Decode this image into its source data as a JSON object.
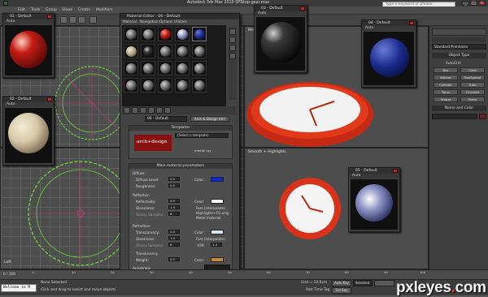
{
  "app": {
    "title": "Autodesk 3ds Max 2010 SP1",
    "file": "Stop-gear.max"
  },
  "menu": [
    "Edit",
    "Tools",
    "Group",
    "Views",
    "Create",
    "Modifiers",
    "Animation",
    "Graph Editors",
    "Rendering",
    "Customize",
    "MAXScript",
    "Help"
  ],
  "search": {
    "placeholder": "Type a keyword or phrase"
  },
  "viewports": {
    "top_left": "Top",
    "top_right": "Perspective",
    "bottom_left": "Left",
    "bottom_right": "Smooth + Highlights"
  },
  "mini_windows": [
    {
      "title": "01 - Default",
      "auto": "Auto",
      "sphere_color": "#c41c14"
    },
    {
      "title": "02 - Default",
      "auto": "Auto",
      "sphere_color": "#d8c9a8"
    },
    {
      "title": "03 - Default",
      "auto": "Auto",
      "sphere_color": "#111111"
    },
    {
      "title": "04 - Default",
      "auto": "Auto",
      "sphere_color": "#1a2c8c"
    },
    {
      "title": "05 - Default",
      "auto": "Auto",
      "sphere_color": "#8e94c4"
    }
  ],
  "material_editor": {
    "title": "Material Editor - 06 - Default",
    "menu": [
      "Material",
      "Navigation",
      "Options",
      "Utilities"
    ],
    "name_field": "06 - Default",
    "type_button": "Arch & Design (mi)",
    "templates_head": "Templates",
    "templates_select": "(Select a template)",
    "logo_text": "arch+design",
    "logo_sub": "mental ray",
    "main_head": "Main material parameters",
    "diffuse": {
      "label": "Diffuse",
      "level_label": "Diffuse Level:",
      "level": "0.0",
      "rough_label": "Roughness:",
      "rough": "0.0",
      "color_label": "Color:",
      "color": "#0a28d8"
    },
    "reflection": {
      "label": "Reflection",
      "refl_label": "Reflectivity:",
      "refl": "0.0",
      "gloss_label": "Glossiness:",
      "gloss": "1.0",
      "samples_label": "Glossy Samples:",
      "samples": "8",
      "color_label": "Color:",
      "fast": "Fast (interpolate)",
      "highlights": "Highlights+FG only",
      "metal": "Metal material"
    },
    "refraction": {
      "label": "Refraction",
      "trans_label": "Transparency:",
      "trans": "0.0",
      "gloss_label": "Glossiness:",
      "gloss": "1.0",
      "samples_label": "Glossy Samples:",
      "samples": "8",
      "fast": "Fast (interpolate)",
      "ior_label": "IOR:",
      "ior": "1.4",
      "translucency_label": "Translucency",
      "translucency_weight_label": "Weight:",
      "translucency_weight": "0.5",
      "color_label": "Color:"
    },
    "aniso": {
      "label": "Anisotropy",
      "aniso_label": "Anisotropy:",
      "aniso": "1.0",
      "rotation_label": "Rotation:",
      "rotation": "0.0"
    }
  },
  "command_panel": {
    "dropdown": "Standard Primitives",
    "object_type_head": "Object Type",
    "autogrid": "AutoGrid",
    "buttons": [
      "Box",
      "Cone",
      "Sphere",
      "GeoSphere",
      "Cylinder",
      "Tube",
      "Torus",
      "Pyramid",
      "Teapot",
      "Plane"
    ],
    "name_color_head": "Name and Color"
  },
  "timeline": {
    "counter": "0 / 100",
    "ticks": [
      "0",
      "10",
      "20",
      "30",
      "40",
      "50",
      "60",
      "70",
      "80",
      "90",
      "100"
    ]
  },
  "status": {
    "maxscript": "Welcome to M",
    "selection": "None Selected",
    "prompt": "Click and drag to select and move objects",
    "grid": "Grid = 10.0cm",
    "autokey": "Auto Key",
    "selected": "Selected",
    "setkey": "Set Key",
    "key_filters": "Key Filters...",
    "add_time_tag": "Add Time Tag"
  },
  "watermark": {
    "main": "pxleyes",
    "dot": ".",
    "tld": "com"
  }
}
